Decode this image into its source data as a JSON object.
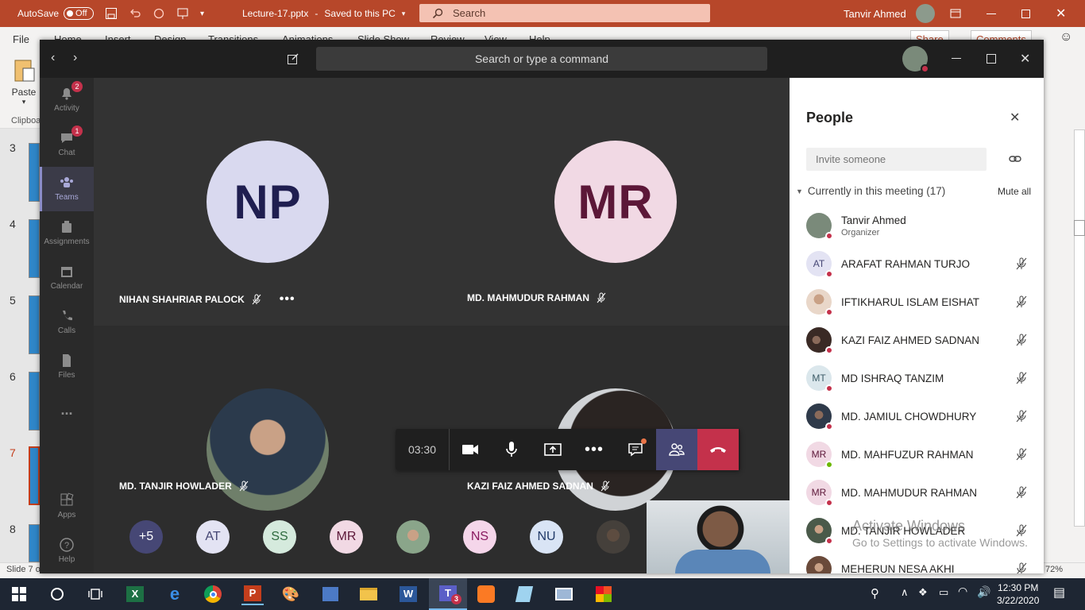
{
  "ppt": {
    "autosave_label": "AutoSave",
    "autosave_state": "Off",
    "filename": "Lecture-17.pptx",
    "save_status": "Saved to this PC",
    "search_placeholder": "Search",
    "user_name": "Tanvir Ahmed",
    "menu": [
      "File",
      "Home",
      "Insert",
      "Design",
      "Transitions",
      "Animations",
      "Slide Show",
      "Review",
      "View",
      "Help"
    ],
    "share_label": "Share",
    "comments_label": "Comments",
    "paste_label": "Paste",
    "clipboard_label": "Clipboa",
    "slide_numbers": [
      "3",
      "4",
      "5",
      "6",
      "7",
      "8"
    ],
    "status_slide": "Slide 7 of",
    "zoom": "72%"
  },
  "teams": {
    "command_placeholder": "Search or type a command",
    "rail": [
      {
        "label": "Activity",
        "badge": "2"
      },
      {
        "label": "Chat",
        "badge": "1"
      },
      {
        "label": "Teams",
        "badge": ""
      },
      {
        "label": "Assignments",
        "badge": ""
      },
      {
        "label": "Calendar",
        "badge": ""
      },
      {
        "label": "Calls",
        "badge": ""
      },
      {
        "label": "Files",
        "badge": ""
      },
      {
        "label": "...",
        "badge": ""
      },
      {
        "label": "Apps",
        "badge": ""
      },
      {
        "label": "Help",
        "badge": ""
      }
    ],
    "tiles": [
      {
        "initials": "NP",
        "name": "NIHAN SHAHRIAR PALOCK",
        "bg": "#d9d9ef",
        "fg": "#1f1e50"
      },
      {
        "initials": "MR",
        "name": "MD. MAHMUDUR RAHMAN",
        "bg": "#f1d9e4",
        "fg": "#5c1738"
      },
      {
        "initials": "",
        "name": "MD. TANJIR HOWLADER",
        "bg": "#4a5a4a",
        "fg": "#fff"
      },
      {
        "initials": "",
        "name": "KAZI FAIZ AHMED SADNAN",
        "bg": "#3a3330",
        "fg": "#fff"
      }
    ],
    "bottom_avatars": [
      {
        "text": "+5",
        "bg": "#464775",
        "fg": "#fff"
      },
      {
        "text": "AT",
        "bg": "#e3e3f3",
        "fg": "#464775"
      },
      {
        "text": "SS",
        "bg": "#d5eadd",
        "fg": "#2f6b3f"
      },
      {
        "text": "MR",
        "bg": "#f1d9e4",
        "fg": "#5c1738"
      },
      {
        "text": "",
        "bg": "#8aa58a",
        "fg": "#fff"
      },
      {
        "text": "NS",
        "bg": "#f5d6ea",
        "fg": "#8a1a60"
      },
      {
        "text": "NU",
        "bg": "#d9e4f5",
        "fg": "#213a68"
      },
      {
        "text": "",
        "bg": "#45403b",
        "fg": "#fff"
      }
    ],
    "call_timer": "03:30",
    "people": {
      "title": "People",
      "invite_placeholder": "Invite someone",
      "section_label": "Currently in this meeting (17)",
      "mute_all": "Mute all",
      "list": [
        {
          "initials": "",
          "name": "Tanvir Ahmed",
          "role": "Organizer",
          "bg": "#7a8a7a",
          "fg": "#fff",
          "status": "busy",
          "mic": false
        },
        {
          "initials": "AT",
          "name": "ARAFAT RAHMAN TURJO",
          "role": "",
          "bg": "#e3e3f3",
          "fg": "#464775",
          "status": "busy",
          "mic": true
        },
        {
          "initials": "",
          "name": "IFTIKHARUL ISLAM EISHAT",
          "role": "",
          "bg": "#e9d7c9",
          "fg": "#fff",
          "status": "busy",
          "mic": true
        },
        {
          "initials": "",
          "name": "KAZI FAIZ AHMED SADNAN",
          "role": "",
          "bg": "#3a2a25",
          "fg": "#fff",
          "status": "busy",
          "mic": true
        },
        {
          "initials": "MT",
          "name": "MD ISHRAQ TANZIM",
          "role": "",
          "bg": "#dbe7ec",
          "fg": "#3b5a66",
          "status": "busy",
          "mic": true
        },
        {
          "initials": "",
          "name": "MD. JAMIUL CHOWDHURY",
          "role": "",
          "bg": "#2f3a4a",
          "fg": "#fff",
          "status": "busy",
          "mic": true
        },
        {
          "initials": "MR",
          "name": "MD. MAHFUZUR RAHMAN",
          "role": "",
          "bg": "#f1d9e4",
          "fg": "#5c1738",
          "status": "available",
          "mic": true
        },
        {
          "initials": "MR",
          "name": "MD. MAHMUDUR RAHMAN",
          "role": "",
          "bg": "#f1d9e4",
          "fg": "#5c1738",
          "status": "busy",
          "mic": true
        },
        {
          "initials": "",
          "name": "MD. TANJIR HOWLADER",
          "role": "",
          "bg": "#4a5a4a",
          "fg": "#fff",
          "status": "busy",
          "mic": true
        },
        {
          "initials": "",
          "name": "MEHERUN NESA AKHI",
          "role": "",
          "bg": "#6a4a3a",
          "fg": "#fff",
          "status": "busy",
          "mic": true
        }
      ]
    }
  },
  "watermark": {
    "line1": "Activate Windows",
    "line2": "Go to Settings to activate Windows."
  },
  "taskbar": {
    "time": "12:30 PM",
    "date": "3/22/2020",
    "teams_badge": "3"
  }
}
